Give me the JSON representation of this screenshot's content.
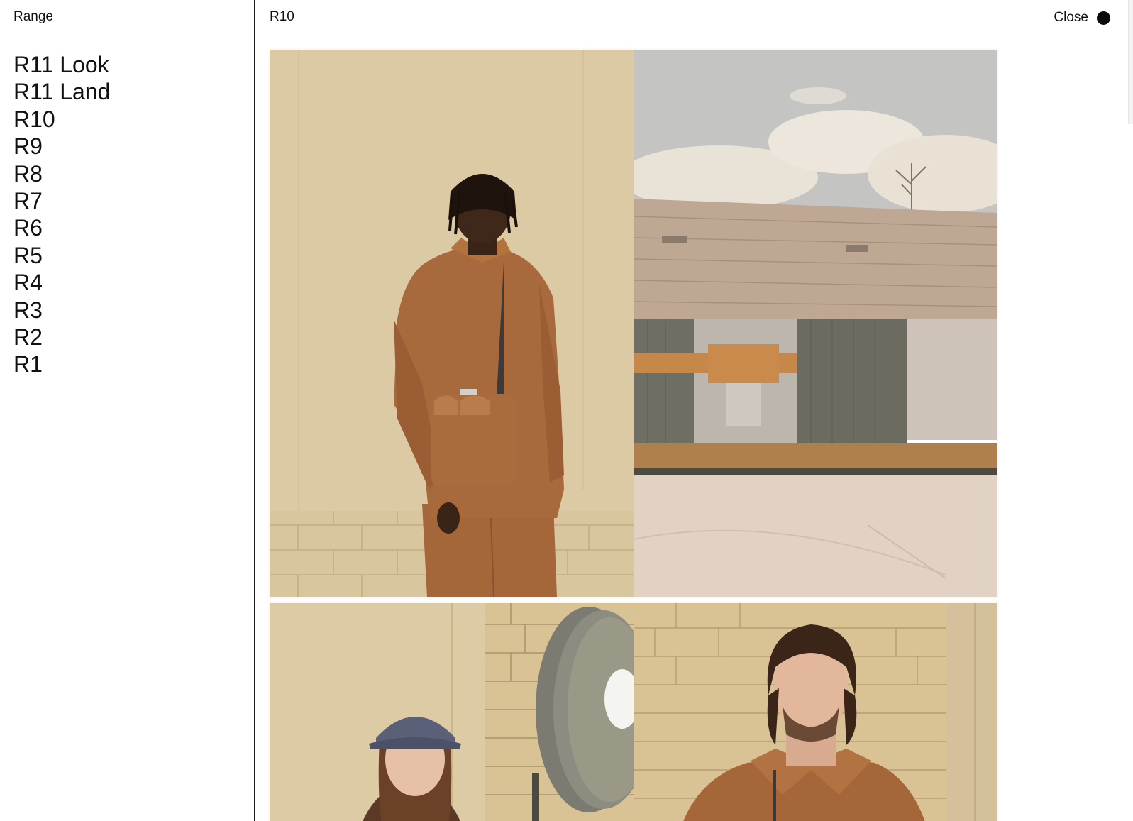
{
  "sidebar": {
    "heading": "Range",
    "items": [
      {
        "label": "R11 Look"
      },
      {
        "label": "R11 Land"
      },
      {
        "label": "R10"
      },
      {
        "label": "R9"
      },
      {
        "label": "R8"
      },
      {
        "label": "R7"
      },
      {
        "label": "R6"
      },
      {
        "label": "R5"
      },
      {
        "label": "R4"
      },
      {
        "label": "R3"
      },
      {
        "label": "R2"
      },
      {
        "label": "R1"
      }
    ]
  },
  "main": {
    "title": "R10",
    "close_label": "Close",
    "close_icon": "filled-circle-icon"
  },
  "gallery": {
    "photos": [
      {
        "icon": "photo-man-brown-jacket-crossbody-bag"
      },
      {
        "icon": "photo-corrugated-shed-under-cloudy-sky"
      },
      {
        "icon": "photo-woman-blue-cap-hose-reel"
      },
      {
        "icon": "photo-man-long-hair-brown-jacket-brick-wall"
      }
    ]
  },
  "colors": {
    "background": "#ffffff",
    "text": "#111111",
    "divider": "#1a1a1a",
    "close_dot": "#0b0b0b",
    "wall_beige": "#dccaa4",
    "jacket_brown": "#a5663a",
    "sky": "#c4c5c3",
    "shed_roof": "#bfa893",
    "brick": "#d9c395"
  }
}
